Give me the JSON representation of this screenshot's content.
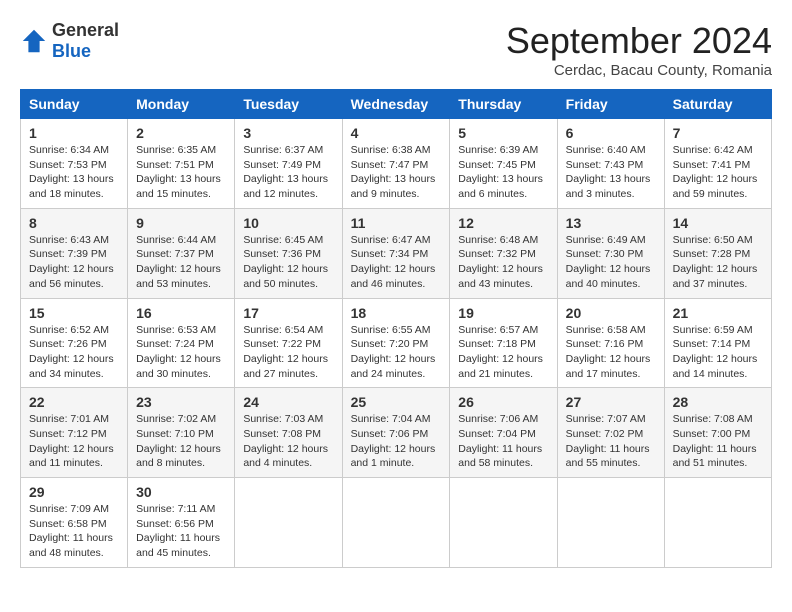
{
  "header": {
    "logo": {
      "general": "General",
      "blue": "Blue"
    },
    "title": "September 2024",
    "subtitle": "Cerdac, Bacau County, Romania"
  },
  "columns": [
    "Sunday",
    "Monday",
    "Tuesday",
    "Wednesday",
    "Thursday",
    "Friday",
    "Saturday"
  ],
  "weeks": [
    [
      {
        "day": "1",
        "info": "Sunrise: 6:34 AM\nSunset: 7:53 PM\nDaylight: 13 hours and 18 minutes."
      },
      {
        "day": "2",
        "info": "Sunrise: 6:35 AM\nSunset: 7:51 PM\nDaylight: 13 hours and 15 minutes."
      },
      {
        "day": "3",
        "info": "Sunrise: 6:37 AM\nSunset: 7:49 PM\nDaylight: 13 hours and 12 minutes."
      },
      {
        "day": "4",
        "info": "Sunrise: 6:38 AM\nSunset: 7:47 PM\nDaylight: 13 hours and 9 minutes."
      },
      {
        "day": "5",
        "info": "Sunrise: 6:39 AM\nSunset: 7:45 PM\nDaylight: 13 hours and 6 minutes."
      },
      {
        "day": "6",
        "info": "Sunrise: 6:40 AM\nSunset: 7:43 PM\nDaylight: 13 hours and 3 minutes."
      },
      {
        "day": "7",
        "info": "Sunrise: 6:42 AM\nSunset: 7:41 PM\nDaylight: 12 hours and 59 minutes."
      }
    ],
    [
      {
        "day": "8",
        "info": "Sunrise: 6:43 AM\nSunset: 7:39 PM\nDaylight: 12 hours and 56 minutes."
      },
      {
        "day": "9",
        "info": "Sunrise: 6:44 AM\nSunset: 7:37 PM\nDaylight: 12 hours and 53 minutes."
      },
      {
        "day": "10",
        "info": "Sunrise: 6:45 AM\nSunset: 7:36 PM\nDaylight: 12 hours and 50 minutes."
      },
      {
        "day": "11",
        "info": "Sunrise: 6:47 AM\nSunset: 7:34 PM\nDaylight: 12 hours and 46 minutes."
      },
      {
        "day": "12",
        "info": "Sunrise: 6:48 AM\nSunset: 7:32 PM\nDaylight: 12 hours and 43 minutes."
      },
      {
        "day": "13",
        "info": "Sunrise: 6:49 AM\nSunset: 7:30 PM\nDaylight: 12 hours and 40 minutes."
      },
      {
        "day": "14",
        "info": "Sunrise: 6:50 AM\nSunset: 7:28 PM\nDaylight: 12 hours and 37 minutes."
      }
    ],
    [
      {
        "day": "15",
        "info": "Sunrise: 6:52 AM\nSunset: 7:26 PM\nDaylight: 12 hours and 34 minutes."
      },
      {
        "day": "16",
        "info": "Sunrise: 6:53 AM\nSunset: 7:24 PM\nDaylight: 12 hours and 30 minutes."
      },
      {
        "day": "17",
        "info": "Sunrise: 6:54 AM\nSunset: 7:22 PM\nDaylight: 12 hours and 27 minutes."
      },
      {
        "day": "18",
        "info": "Sunrise: 6:55 AM\nSunset: 7:20 PM\nDaylight: 12 hours and 24 minutes."
      },
      {
        "day": "19",
        "info": "Sunrise: 6:57 AM\nSunset: 7:18 PM\nDaylight: 12 hours and 21 minutes."
      },
      {
        "day": "20",
        "info": "Sunrise: 6:58 AM\nSunset: 7:16 PM\nDaylight: 12 hours and 17 minutes."
      },
      {
        "day": "21",
        "info": "Sunrise: 6:59 AM\nSunset: 7:14 PM\nDaylight: 12 hours and 14 minutes."
      }
    ],
    [
      {
        "day": "22",
        "info": "Sunrise: 7:01 AM\nSunset: 7:12 PM\nDaylight: 12 hours and 11 minutes."
      },
      {
        "day": "23",
        "info": "Sunrise: 7:02 AM\nSunset: 7:10 PM\nDaylight: 12 hours and 8 minutes."
      },
      {
        "day": "24",
        "info": "Sunrise: 7:03 AM\nSunset: 7:08 PM\nDaylight: 12 hours and 4 minutes."
      },
      {
        "day": "25",
        "info": "Sunrise: 7:04 AM\nSunset: 7:06 PM\nDaylight: 12 hours and 1 minute."
      },
      {
        "day": "26",
        "info": "Sunrise: 7:06 AM\nSunset: 7:04 PM\nDaylight: 11 hours and 58 minutes."
      },
      {
        "day": "27",
        "info": "Sunrise: 7:07 AM\nSunset: 7:02 PM\nDaylight: 11 hours and 55 minutes."
      },
      {
        "day": "28",
        "info": "Sunrise: 7:08 AM\nSunset: 7:00 PM\nDaylight: 11 hours and 51 minutes."
      }
    ],
    [
      {
        "day": "29",
        "info": "Sunrise: 7:09 AM\nSunset: 6:58 PM\nDaylight: 11 hours and 48 minutes."
      },
      {
        "day": "30",
        "info": "Sunrise: 7:11 AM\nSunset: 6:56 PM\nDaylight: 11 hours and 45 minutes."
      },
      {
        "day": "",
        "info": ""
      },
      {
        "day": "",
        "info": ""
      },
      {
        "day": "",
        "info": ""
      },
      {
        "day": "",
        "info": ""
      },
      {
        "day": "",
        "info": ""
      }
    ]
  ]
}
